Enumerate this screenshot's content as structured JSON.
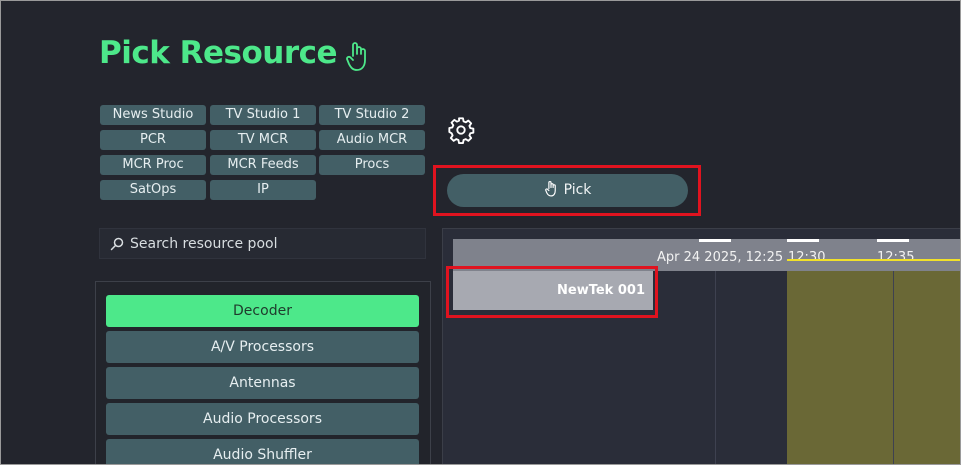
{
  "title": "Pick Resource",
  "title_icon": "hand-pointer-icon",
  "resource_groups": [
    "News Studio",
    "TV Studio 1",
    "TV Studio 2",
    "PCR",
    "TV MCR",
    "Audio MCR",
    "MCR Proc",
    "MCR Feeds",
    "Procs",
    "SatOps",
    "IP"
  ],
  "settings_icon": "gear-icon",
  "pick_button": {
    "label": "Pick",
    "icon": "hand-pointer-icon"
  },
  "search": {
    "placeholder": "Search resource pool",
    "value": "",
    "icon": "search-icon"
  },
  "categories": [
    {
      "label": "Decoder",
      "active": true
    },
    {
      "label": "A/V Processors",
      "active": false
    },
    {
      "label": "Antennas",
      "active": false
    },
    {
      "label": "Audio Processors",
      "active": false
    },
    {
      "label": "Audio Shuffler",
      "active": false
    }
  ],
  "timeline": {
    "header_date": "Apr 24 2025, 12:25",
    "ticks": [
      "12:30",
      "12:35"
    ],
    "resource": "NewTek 001"
  },
  "colors": {
    "accent": "#4de88a",
    "chip": "#435f66",
    "highlight": "#e0131f",
    "now_line": "#f1e12a",
    "background": "#23252d"
  }
}
